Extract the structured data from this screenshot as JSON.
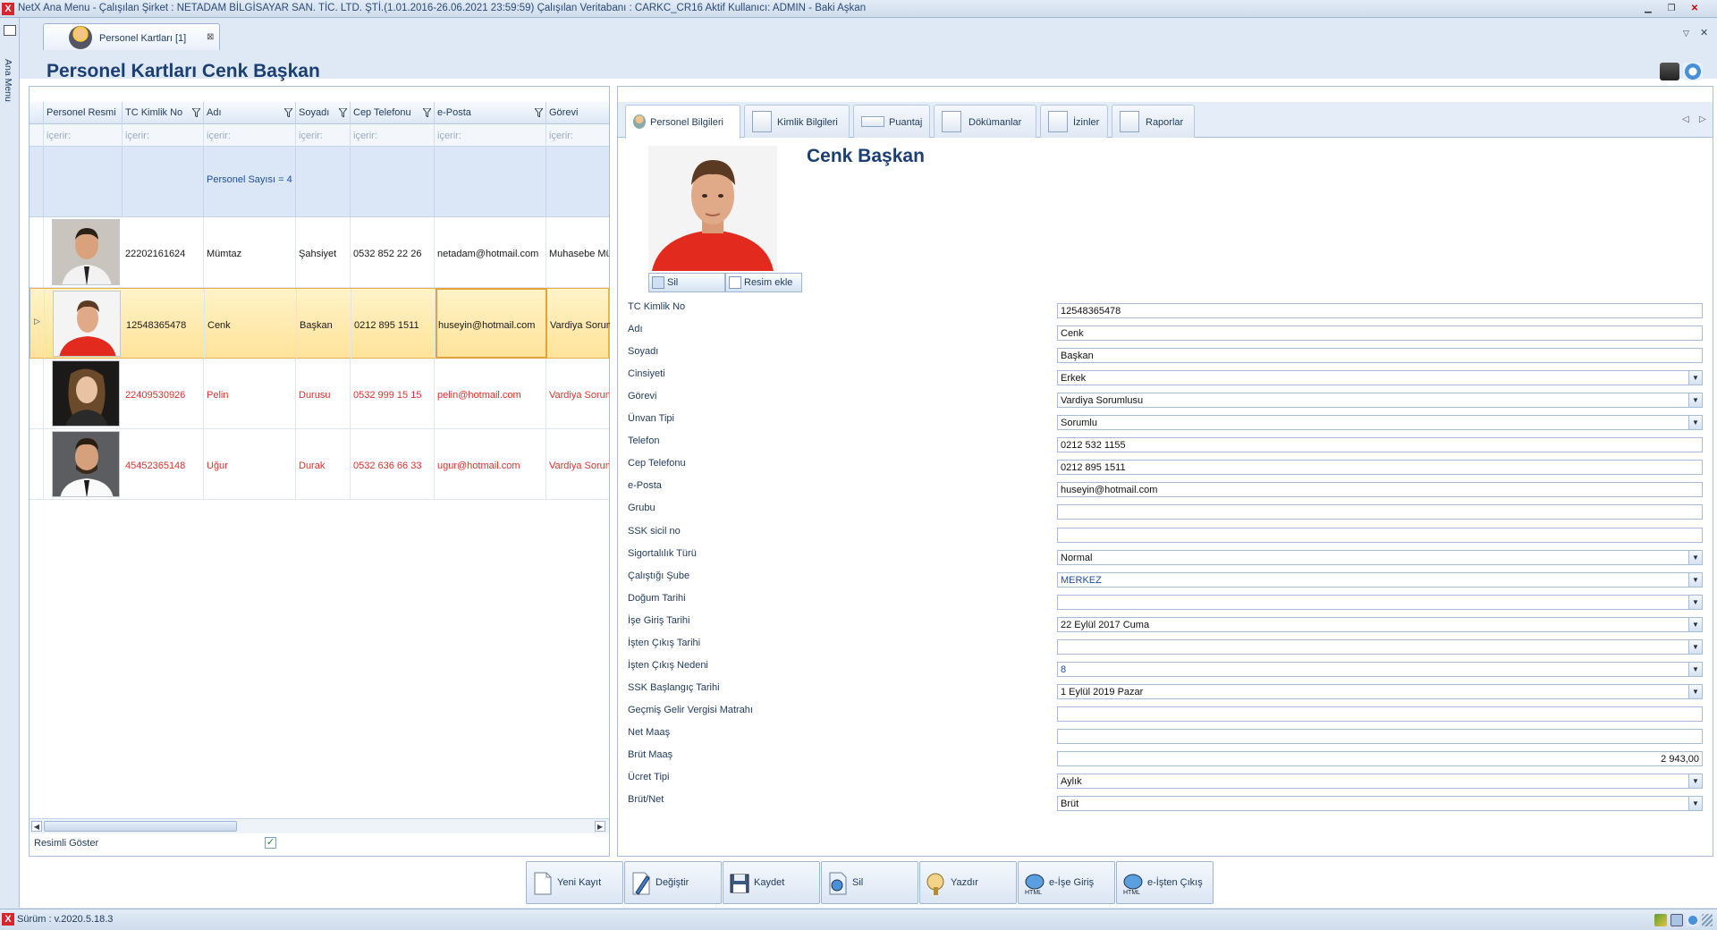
{
  "window": {
    "title": "NetX Ana Menu - Çalışılan Şirket : NETADAM BİLGİSAYAR SAN. TİC. LTD. ŞTİ.(1.01.2016-26.06.2021 23:59:59) Çalışılan Veritabanı : CARKC_CR16  Aktif Kullanıcı: ADMIN - Baki Aşkan",
    "logo": "X"
  },
  "sidebar": {
    "label": "Ana Menu"
  },
  "doc_tab": {
    "label": "Personel Kartları [1]",
    "close": "⊠"
  },
  "page_title": "Personel Kartları Cenk Başkan",
  "grid": {
    "columns": [
      "Personel Resmi",
      "TC Kimlik No",
      "Adı",
      "Soyadı",
      "Cep Telefonu",
      "e-Posta",
      "Görevi"
    ],
    "filter_placeholder": "içerir:",
    "summary": "Personel Sayısı = 4",
    "rows": [
      {
        "tc": "22202161624",
        "ad": "Mümtaz",
        "soyad": "Şahsiyet",
        "cep": "0532 852 22 26",
        "eposta": "netadam@hotmail.com",
        "gorev": "Muhasebe Müdürü",
        "style": "normal"
      },
      {
        "tc": "12548365478",
        "ad": "Cenk",
        "soyad": "Başkan",
        "cep": "0212 895 1511",
        "eposta": "huseyin@hotmail.com",
        "gorev": "Vardiya Sorumlusu",
        "style": "selected"
      },
      {
        "tc": "22409530926",
        "ad": "Pelin",
        "soyad": "Durusu",
        "cep": "0532 999 15 15",
        "eposta": "pelin@hotmail.com",
        "gorev": "Vardiya Sorumlusu",
        "style": "red"
      },
      {
        "tc": "45452365148",
        "ad": "Uğur",
        "soyad": "Durak",
        "cep": "0532 636 66 33",
        "eposta": "ugur@hotmail.com",
        "gorev": "Vardiya Sorumlusu",
        "style": "red"
      }
    ]
  },
  "resimli_goster": {
    "label": "Resimli Göster",
    "checked": true
  },
  "detail_tabs": [
    "Personel Bilgileri",
    "Kimlik Bilgileri",
    "Puantaj",
    "Dökümanlar",
    "İzinler",
    "Raporlar"
  ],
  "photo_buttons": {
    "delete": "Sil",
    "add": "Resim ekle"
  },
  "person_name": "Cenk Başkan",
  "form": [
    {
      "label": "TC Kimlik No",
      "value": "12548365478",
      "type": "text"
    },
    {
      "label": "Adı",
      "value": "Cenk",
      "type": "text"
    },
    {
      "label": "Soyadı",
      "value": "Başkan",
      "type": "text"
    },
    {
      "label": "Cinsiyeti",
      "value": "Erkek",
      "type": "select"
    },
    {
      "label": "Görevi",
      "value": "Vardiya Sorumlusu",
      "type": "select"
    },
    {
      "label": "Ünvan Tipi",
      "value": "Sorumlu",
      "type": "select"
    },
    {
      "label": "Telefon",
      "value": "0212 532 1155",
      "type": "text"
    },
    {
      "label": "Cep Telefonu",
      "value": "0212 895 1511",
      "type": "text"
    },
    {
      "label": "e-Posta",
      "value": "huseyin@hotmail.com",
      "type": "text"
    },
    {
      "label": "Grubu",
      "value": "",
      "type": "text"
    },
    {
      "label": "SSK sicil no",
      "value": "",
      "type": "text"
    },
    {
      "label": "Sigortalılık Türü",
      "value": "Normal",
      "type": "select"
    },
    {
      "label": "Çalıştığı Şube",
      "value": "MERKEZ",
      "type": "select"
    },
    {
      "label": "Doğum Tarihi",
      "value": "",
      "type": "select"
    },
    {
      "label": "İşe Giriş Tarihi",
      "value": "22 Eylül 2017 Cuma",
      "type": "select"
    },
    {
      "label": "İşten Çıkış Tarihi",
      "value": "",
      "type": "select"
    },
    {
      "label": "İşten Çıkış Nedeni",
      "value": "8",
      "type": "select"
    },
    {
      "label": "SSK Başlangıç Tarihi",
      "value": "1 Eylül 2019 Pazar",
      "type": "select"
    },
    {
      "label": "Geçmiş Gelir Vergisi Matrahı",
      "value": "",
      "type": "text"
    },
    {
      "label": "Net Maaş",
      "value": "",
      "type": "text"
    },
    {
      "label": "Brüt Maaş",
      "value": "2 943,00",
      "type": "number"
    },
    {
      "label": "Ücret Tipi",
      "value": "Aylık",
      "type": "select"
    },
    {
      "label": "Brüt/Net",
      "value": "Brüt",
      "type": "select"
    }
  ],
  "toolbar": [
    "Yeni Kayıt",
    "Değiştir",
    "Kaydet",
    "Sil",
    "Yazdır",
    "e-İşe Giriş",
    "e-İşten Çıkış"
  ],
  "status": {
    "version": "Sürüm : v.2020.5.18.3"
  },
  "colors": {
    "accent": "#1b3f73",
    "selected_row": "#ffe39a",
    "red_row_text": "#e0302b"
  }
}
